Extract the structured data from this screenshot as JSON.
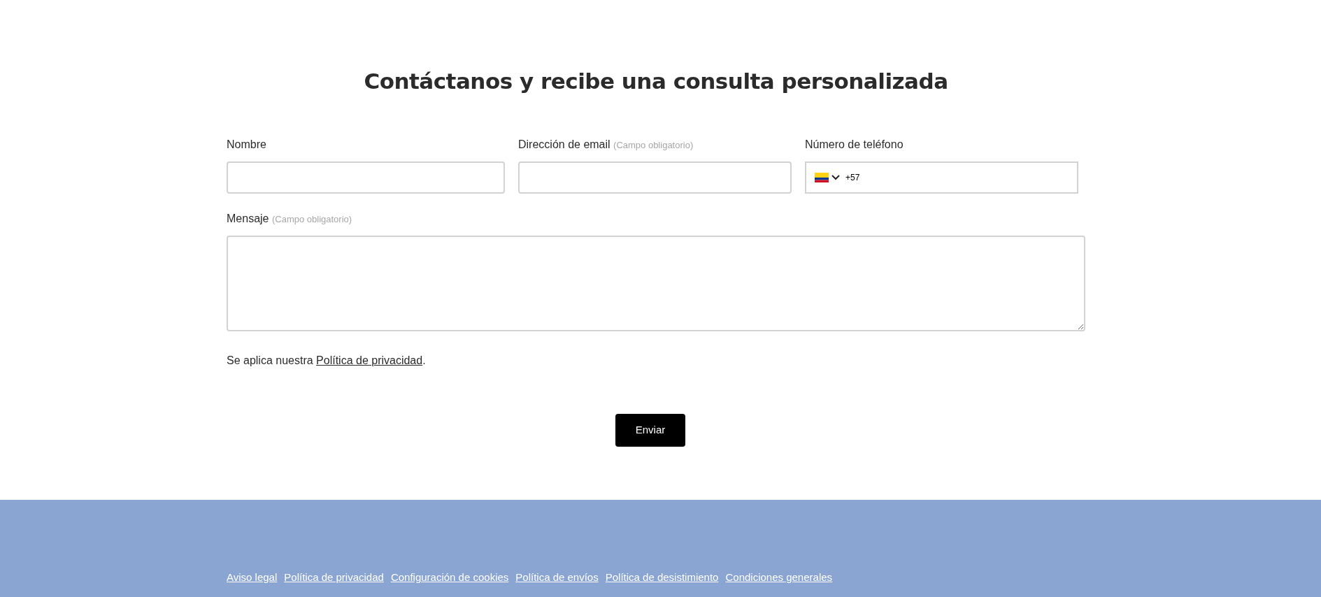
{
  "heading": "Contáctanos y recibe una consulta personalizada",
  "fields": [
    {
      "kind": "text",
      "label": "Nombre"
    },
    {
      "kind": "email",
      "label": "Dirección de email",
      "hint": "(Campo obligatorio)"
    },
    {
      "kind": "phone",
      "label": "Número de teléfono",
      "value": "+57"
    }
  ],
  "message": {
    "label": "Mensaje",
    "hint": "(Campo obligatorio)"
  },
  "privacy": {
    "before": "Se aplica nuestra ",
    "link": "Política de privacidad",
    "after": "."
  },
  "submit": "Enviar",
  "footer_links": [
    "Aviso legal",
    "Política de privacidad",
    "Configuración de cookies",
    "Política de envíos",
    "Política de desistimiento",
    "Condiciones generales"
  ]
}
